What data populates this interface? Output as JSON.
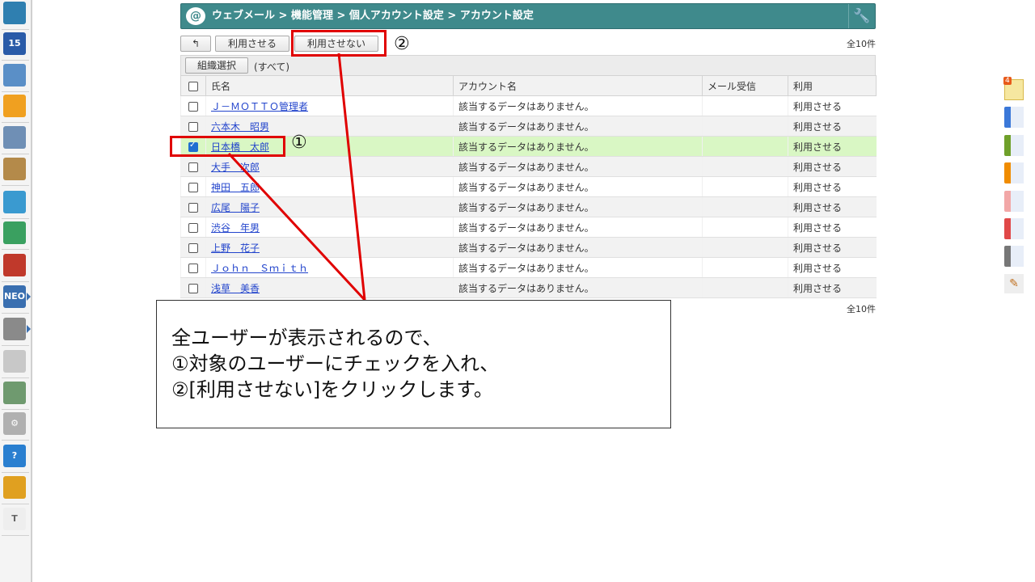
{
  "left_sidebar": {
    "icons": [
      {
        "name": "portal-icon",
        "color": "#2f7fb0",
        "glyph": ""
      },
      {
        "name": "calendar-icon",
        "color": "#2a5ba8",
        "glyph": "15"
      },
      {
        "name": "facility-icon",
        "color": "#5a8fc7",
        "glyph": ""
      },
      {
        "name": "memo-icon",
        "color": "#f0a020",
        "glyph": ""
      },
      {
        "name": "bulletin-icon",
        "color": "#6f8fb5",
        "glyph": ""
      },
      {
        "name": "clipboard-icon",
        "color": "#b48a4a",
        "glyph": ""
      },
      {
        "name": "search-doc-icon",
        "color": "#3a9ad0",
        "glyph": ""
      },
      {
        "name": "refresh-icon",
        "color": "#3aa060",
        "glyph": ""
      },
      {
        "name": "binder-icon",
        "color": "#c0392b",
        "glyph": ""
      },
      {
        "name": "neo-icon",
        "color": "#3a6fb0",
        "glyph": "NEO"
      },
      {
        "name": "folder-icon",
        "color": "#8a8a8a",
        "glyph": ""
      },
      {
        "name": "app-icon",
        "color": "#c8c8c8",
        "glyph": ""
      },
      {
        "name": "image-app-icon",
        "color": "#6f9a6f",
        "glyph": ""
      },
      {
        "name": "settings-icon",
        "color": "#b0b0b0",
        "glyph": "⚙"
      },
      {
        "name": "help-icon",
        "color": "#2a7fd0",
        "glyph": "?"
      },
      {
        "name": "support-icon",
        "color": "#e0a020",
        "glyph": ""
      },
      {
        "name": "text-icon",
        "color": "#eeeeee",
        "glyph": "T"
      }
    ]
  },
  "right_sidebar": {
    "badge": "4",
    "tabs": [
      "#3b78d8",
      "#6fa02a",
      "#f08c00",
      "#f2a7a7",
      "#e04848",
      "#777777"
    ]
  },
  "header": {
    "breadcrumb": "ウェブメール > 機能管理 > 個人アカウント設定 > アカウント設定"
  },
  "toolbar": {
    "back_glyph": "↰",
    "enable_label": "利用させる",
    "disable_label": "利用させない",
    "total": "全10件"
  },
  "filter": {
    "button_label": "組織選択",
    "value": "(すべて)"
  },
  "table": {
    "columns": [
      "氏名",
      "アカウント名",
      "メール受信",
      "利用"
    ],
    "rows": [
      {
        "name": "Ｊ－ＭＯＴＴＯ管理者",
        "account": "該当するデータはありません。",
        "receive": "",
        "usage": "利用させる"
      },
      {
        "name": "六本木　昭男",
        "account": "該当するデータはありません。",
        "receive": "",
        "usage": "利用させる"
      },
      {
        "name": "日本橋　太郎",
        "account": "該当するデータはありません。",
        "receive": "",
        "usage": "利用させる"
      },
      {
        "name": "大手　次郎",
        "account": "該当するデータはありません。",
        "receive": "",
        "usage": "利用させる"
      },
      {
        "name": "神田　五郎",
        "account": "該当するデータはありません。",
        "receive": "",
        "usage": "利用させる"
      },
      {
        "name": "広尾　陽子",
        "account": "該当するデータはありません。",
        "receive": "",
        "usage": "利用させる"
      },
      {
        "name": "渋谷　年男",
        "account": "該当するデータはありません。",
        "receive": "",
        "usage": "利用させる"
      },
      {
        "name": "上野　花子",
        "account": "該当するデータはありません。",
        "receive": "",
        "usage": "利用させる"
      },
      {
        "name": "Ｊｏｈｎ　Ｓｍｉｔｈ",
        "account": "該当するデータはありません。",
        "receive": "",
        "usage": "利用させる"
      },
      {
        "name": "浅草　美香",
        "account": "該当するデータはありません。",
        "receive": "",
        "usage": "利用させる"
      }
    ],
    "selected_index": 2,
    "total_bottom": "全10件"
  },
  "annotations": {
    "marker1": "①",
    "marker2": "②",
    "callout_lines": [
      "全ユーザーが表示されるので、",
      "①対象のユーザーにチェックを入れ、",
      "②[利用させない]をクリックします。"
    ],
    "color": "#e00000"
  }
}
